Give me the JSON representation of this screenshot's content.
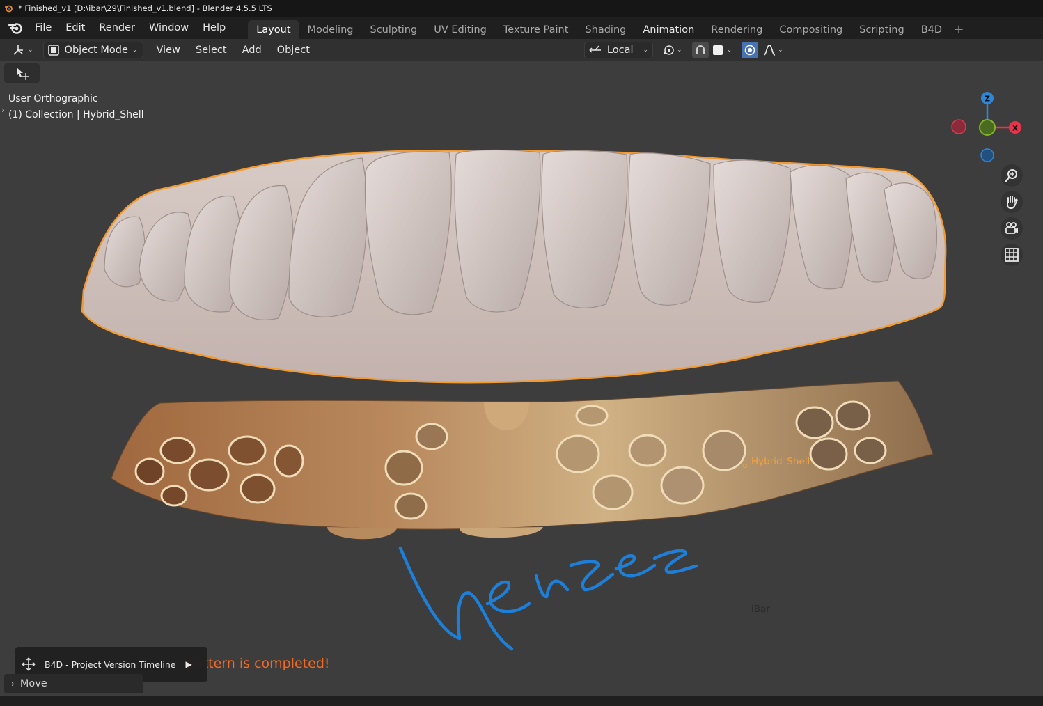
{
  "window": {
    "title": "* Finished_v1 [D:\\ibar\\29\\Finished_v1.blend] - Blender 4.5.5 LTS"
  },
  "menu": {
    "items": [
      "File",
      "Edit",
      "Render",
      "Window",
      "Help"
    ]
  },
  "workspaces": {
    "tabs": [
      "Layout",
      "Modeling",
      "Sculpting",
      "UV Editing",
      "Texture Paint",
      "Shading",
      "Animation",
      "Rendering",
      "Compositing",
      "Scripting",
      "B4D"
    ],
    "active": "Layout",
    "add": "+"
  },
  "header": {
    "mode": "Object Mode",
    "menus": [
      "View",
      "Select",
      "Add",
      "Object"
    ],
    "transform_orientation": "Local"
  },
  "viewport": {
    "view_name": "User Orthographic",
    "collection": "(1) Collection | Hybrid_Shell",
    "object_label": "Hybrid_Shell",
    "ibar_label": "iBar",
    "status_message": "pattern is completed!",
    "signature": "Nenzez",
    "gizmo": {
      "z": "Z",
      "x": "X"
    }
  },
  "popup": {
    "label": "B4D - Project Version Timeline",
    "play": "▶"
  },
  "operator_panel": {
    "label": "Move"
  },
  "colors": {
    "accent_orange": "#f5a23b",
    "axis_x": "#e8334c",
    "axis_y": "#7fb42a",
    "axis_z": "#2e86d9",
    "signature_blue": "#1e7fd8",
    "status_orange": "#f46a22"
  }
}
